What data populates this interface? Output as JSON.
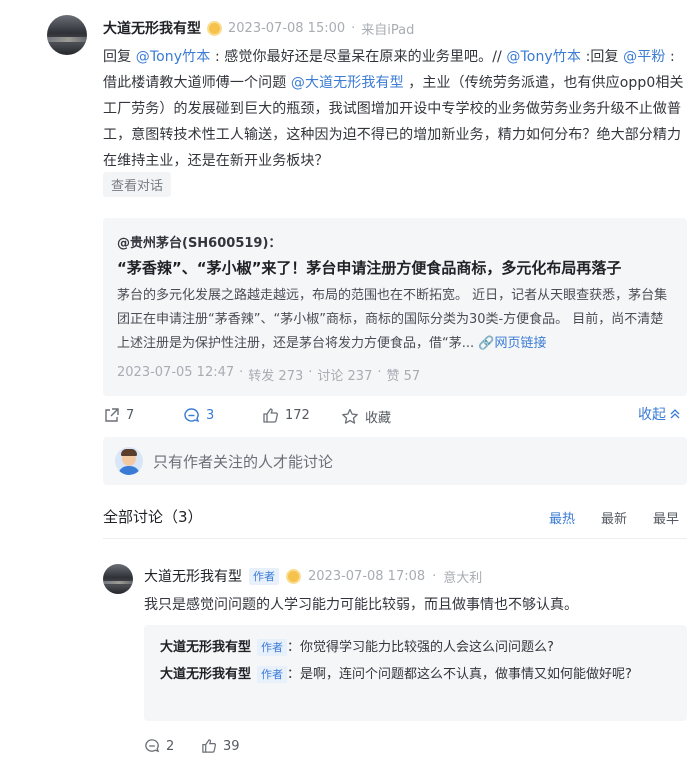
{
  "post": {
    "author": "大道无形我有型",
    "time": "2023-07-08 15:00",
    "source": "来自iPad",
    "text_parts": {
      "reply_prefix": "回复",
      "mention1": "@Tony竹本",
      "seg1": ": 感觉你最好还是尽量呆在原来的业务里吧。//",
      "mention2": "@Tony竹本",
      "seg2": ":回复",
      "mention3": "@平粉",
      "seg3": ": 借此楼请教大道师傅一个问题",
      "mention4": "@大道无形我有型",
      "seg4": "，主业（传统劳务派遣，也有供应opp0相关工厂劳务）的发展碰到巨大的瓶颈，我试图增加开设中专学校的业务做劳务业务升级不止做普工，意图转技术性工人输送，这种因为迫不得已的增加新业务，精力如何分布？绝大部分精力在维持主业，还是在新开业务板块？"
    },
    "view_conversation": "查看对话"
  },
  "quote": {
    "account": "@贵州茅台(SH600519)：",
    "title": "“茅香辣”、“茅小椒”来了！茅台申请注册方便食品商标，多元化布局再落子",
    "body": "茅台的多元化发展之路越走越远，布局的范围也在不断拓宽。 近日，记者从天眼查获悉，茅台集团正在申请注册“茅香辣”、“茅小椒”商标，商标的国际分类为30类-方便食品。 目前，尚不清楚上述注册是为保护性注册，还是茅台将发力方便食品，借“茅...",
    "web_link": "网页链接",
    "time": "2023-07-05 12:47",
    "sep": "·",
    "reposts": "转发 273",
    "comments": "讨论 237",
    "likes": "赞 57"
  },
  "actions": {
    "repost_count": "7",
    "comment_count": "3",
    "like_count": "172",
    "favorite_label": "收藏",
    "collapse_label": "收起"
  },
  "comment_box": {
    "placeholder": "只有作者关注的人才能讨论"
  },
  "discussion": {
    "header": "全部讨论（3）",
    "sort_hot": "最热",
    "sort_new": "最新",
    "sort_early": "最早",
    "colors": {
      "active": "#3a7bd5",
      "inactive": "#555a62"
    }
  },
  "comment": {
    "author": "大道无形我有型",
    "author_tag": "作者",
    "time": "2023-07-08 17:08",
    "location": "意大利",
    "text": "我只是感觉问问题的人学习能力可能比较弱，而且做事情也不够认真。",
    "replies": [
      {
        "author": "大道无形我有型",
        "tag": "作者",
        "text": "：你觉得学习能力比较强的人会这么问问题么?"
      },
      {
        "author": "大道无形我有型",
        "tag": "作者",
        "text": "：是啊，连问个问题都这么不认真，做事情又如何能做好呢?"
      }
    ],
    "reply_count": "2",
    "like_count": "39"
  }
}
